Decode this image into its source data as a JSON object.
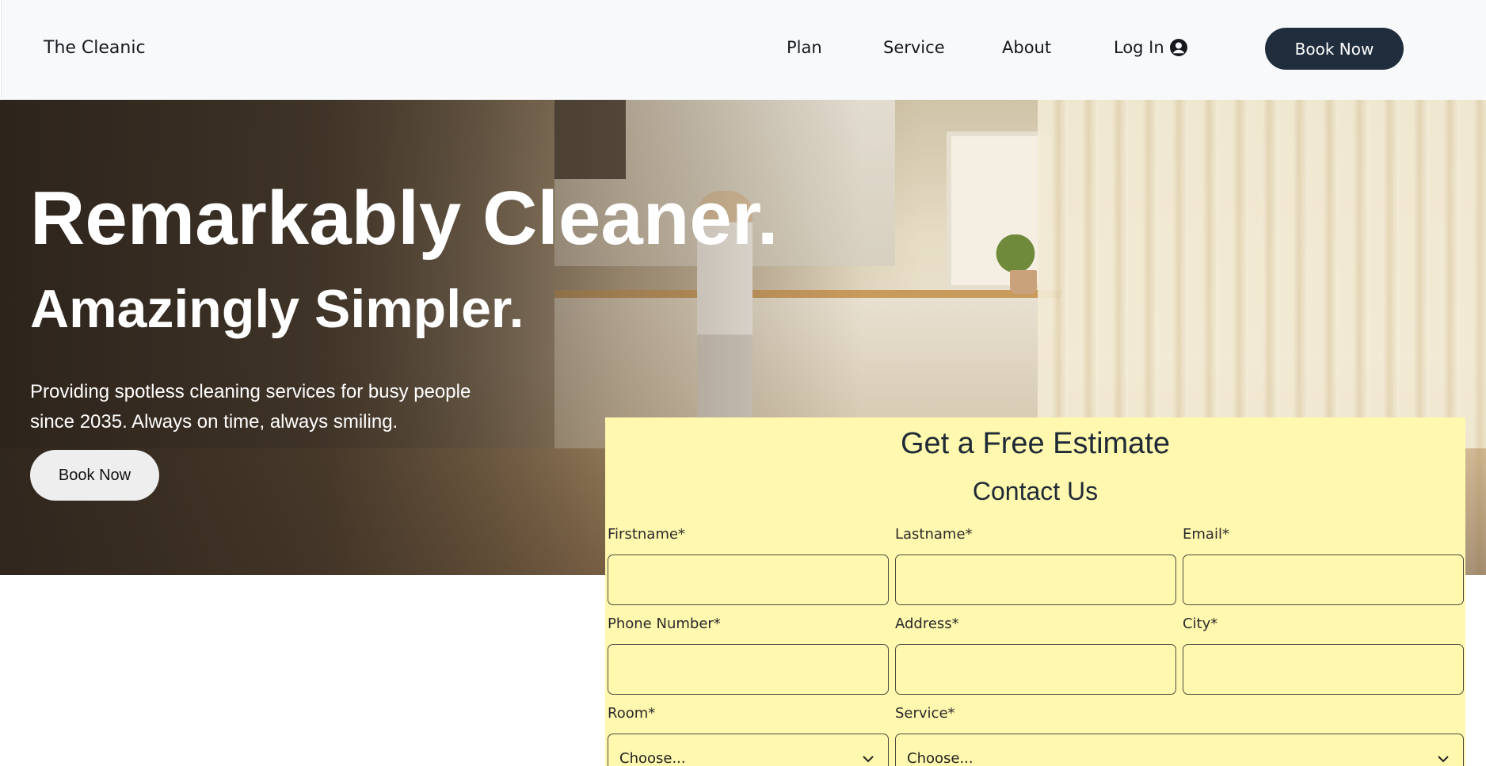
{
  "navbar": {
    "brand": "The Cleanic",
    "links": [
      "Plan",
      "Service",
      "About"
    ],
    "login_label": "Log In",
    "book_label": "Book Now"
  },
  "hero": {
    "title": "Remarkably Cleaner.",
    "subtitle": "Amazingly Simpler.",
    "description": "Providing spotless cleaning services for busy people since 2035. Always on time, always smiling.",
    "book_label": "Book Now"
  },
  "estimate": {
    "title": "Get a Free Estimate",
    "subtitle": "Contact Us",
    "fields": {
      "firstname": {
        "label": "Firstname*",
        "value": ""
      },
      "lastname": {
        "label": "Lastname*",
        "value": ""
      },
      "email": {
        "label": "Email*",
        "value": ""
      },
      "phone": {
        "label": "Phone Number*",
        "value": ""
      },
      "address": {
        "label": "Address*",
        "value": ""
      },
      "city": {
        "label": "City*",
        "value": ""
      },
      "room": {
        "label": "Room*",
        "selected": "Choose..."
      },
      "service": {
        "label": "Service*",
        "selected": "Choose..."
      }
    }
  },
  "colors": {
    "navbar_bg": "#f7f9fb",
    "accent_button": "#1f2d3d",
    "form_bg": "#fff8ae"
  },
  "icons": {
    "login": "user-circle-icon",
    "select": "chevron-down-icon"
  }
}
